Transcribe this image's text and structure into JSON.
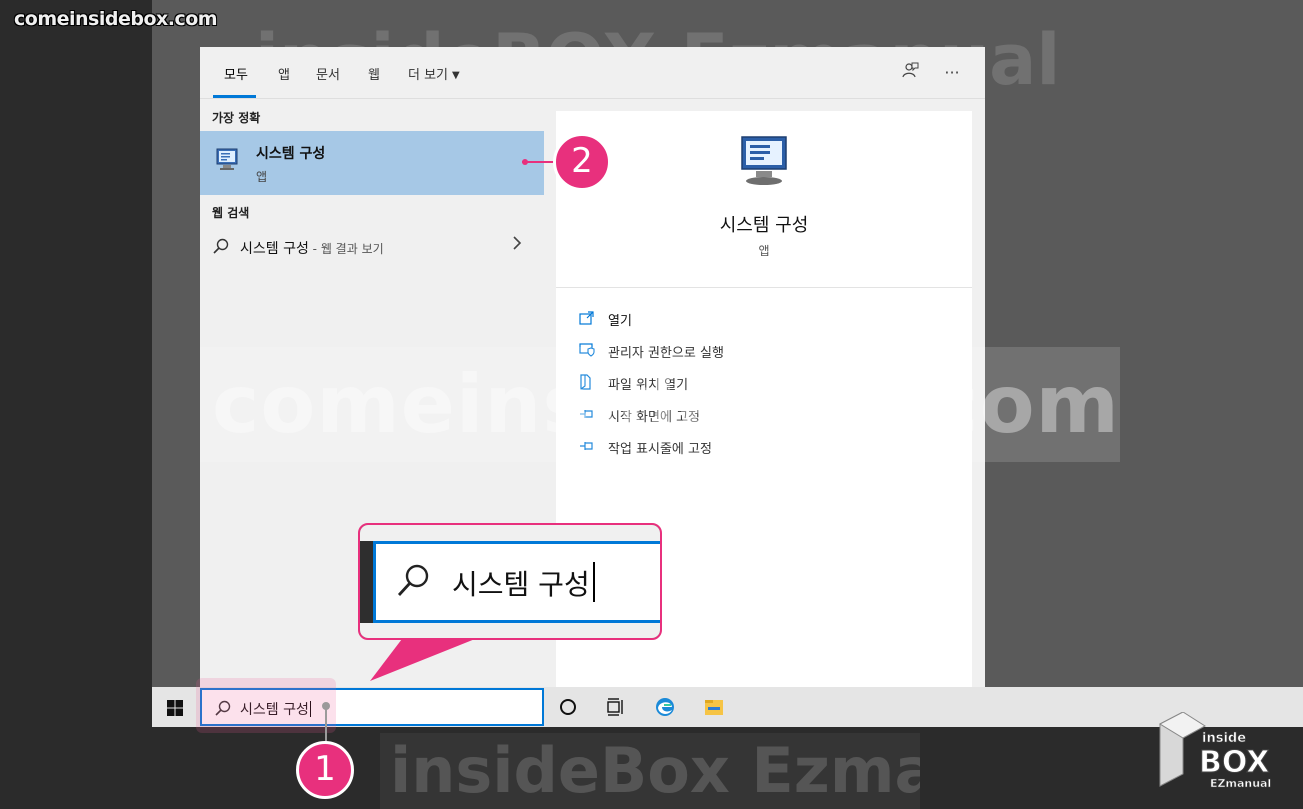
{
  "site_label": "comeinsidebox.com",
  "watermarks": {
    "top": "insideBOX Ezmanual",
    "middle": "comeinsidebox.com",
    "bottom": "insideBox Ezmanual"
  },
  "tabs": [
    {
      "label": "모두",
      "active": true
    },
    {
      "label": "앱"
    },
    {
      "label": "문서"
    },
    {
      "label": "웹"
    },
    {
      "label": "더 보기"
    }
  ],
  "toolbar_icons": [
    "feedback-icon",
    "more-options-icon"
  ],
  "best_match": {
    "header": "가장 정확",
    "title": "시스템 구성",
    "subtitle": "앱"
  },
  "web_search": {
    "header": "웹 검색",
    "query": "시스템 구성",
    "suffix": " - 웹 결과 보기"
  },
  "detail": {
    "title": "시스템 구성",
    "subtitle": "앱",
    "actions": [
      {
        "label": "열기",
        "icon": "open-icon"
      },
      {
        "label": "관리자 권한으로 실행",
        "icon": "shield-icon"
      },
      {
        "label": "파일 위치 열기",
        "icon": "file-location-icon"
      },
      {
        "label": "시작 화면에 고정",
        "icon": "pin-icon"
      },
      {
        "label": "작업 표시줄에 고정",
        "icon": "pin-icon"
      }
    ]
  },
  "taskbar": {
    "search_value": "시스템 구성"
  },
  "zoom_callout": {
    "text": "시스템 구성"
  },
  "badges": {
    "one": "1",
    "two": "2"
  },
  "logo": {
    "line1": "inside",
    "line2": "BOX",
    "line3": "EZmanual"
  },
  "colors": {
    "accent": "#0078d7",
    "highlight": "#a6c8e6",
    "badge": "#e8307d"
  }
}
